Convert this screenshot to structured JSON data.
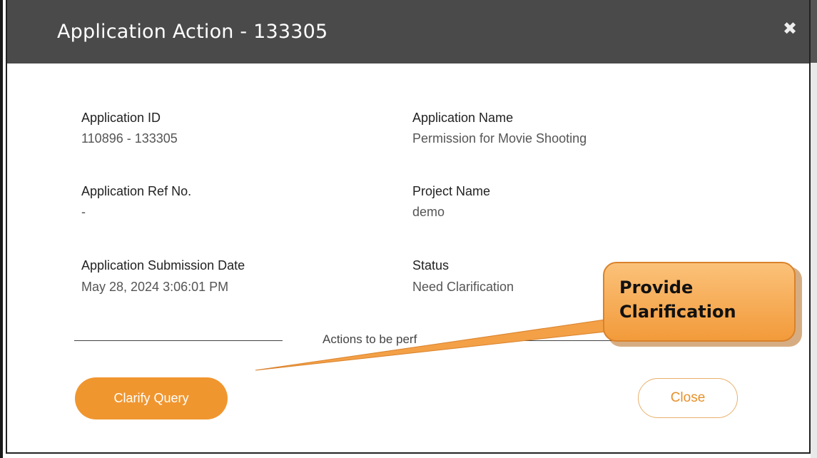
{
  "modal": {
    "title": "Application Action - 133305",
    "close_icon": "close-icon",
    "fields": {
      "application_id_label": "Application ID",
      "application_id_value": "110896 - 133305",
      "application_name_label": "Application Name",
      "application_name_value": "Permission for Movie Shooting",
      "ref_no_label": "Application Ref No.",
      "ref_no_value": "-",
      "project_name_label": "Project Name",
      "project_name_value": "demo",
      "submission_date_label": "Application Submission Date",
      "submission_date_value": "May 28, 2024 3:06:01 PM",
      "status_label": "Status",
      "status_value": "Need Clarification"
    },
    "actions_caption": "Actions to be perf",
    "buttons": {
      "clarify_label": "Clarify Query",
      "close_label": "Close"
    }
  },
  "callout": {
    "line1": "Provide",
    "line2": "Clarification"
  },
  "colors": {
    "header_bg": "#4a4a4a",
    "accent_orange": "#f0962f",
    "callout_fill": "#f6a94f",
    "callout_border": "#d9822b"
  }
}
